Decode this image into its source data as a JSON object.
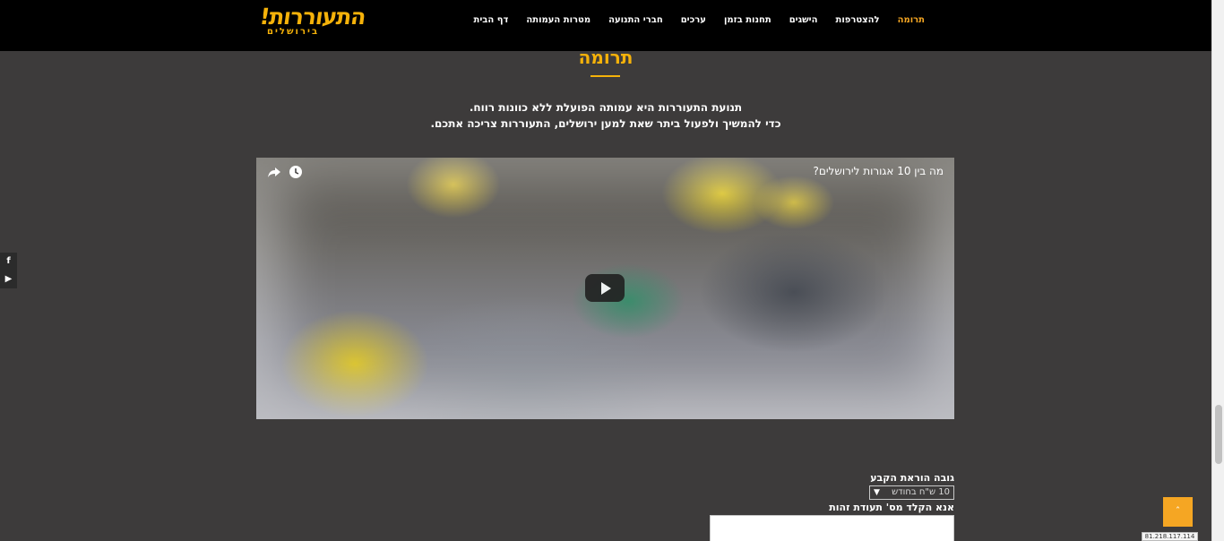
{
  "header": {
    "logo_main": "התעוררות!",
    "logo_sub": "בירושלים",
    "nav": [
      {
        "label": "דף הבית"
      },
      {
        "label": "מטרות העמותה"
      },
      {
        "label": "חברי התנועה"
      },
      {
        "label": "ערכים"
      },
      {
        "label": "תחנות בזמן"
      },
      {
        "label": "הישגים"
      },
      {
        "label": "להצטרפות"
      },
      {
        "label": "תרומה"
      }
    ],
    "active_item": "תרומה",
    "accent_color": "#f5a623"
  },
  "social": {
    "facebook": "f",
    "youtube": "▶"
  },
  "main": {
    "title": "תרומה",
    "intro_line1": "תנועת התעוררות היא עמותה הפועלת ללא כוונות רווח.",
    "intro_line2": "כדי להמשיך ולפעול ביתר שאת למען ירושלים, התעוררות צריכה אתכם."
  },
  "video": {
    "title": "מה בין 10 אגורות לירושלים?",
    "share_icon": "share-icon",
    "watch_later_icon": "clock-icon",
    "play_icon": "play-icon"
  },
  "form": {
    "standing_order_label": "גובה הוראת הקבע",
    "standing_order_value": "10 ש\"ח בחודש",
    "id_label": "אנא הקלד מס' תעודת זהות"
  },
  "back_to_top": "ˆ",
  "ip_address": "81.218.117.114"
}
